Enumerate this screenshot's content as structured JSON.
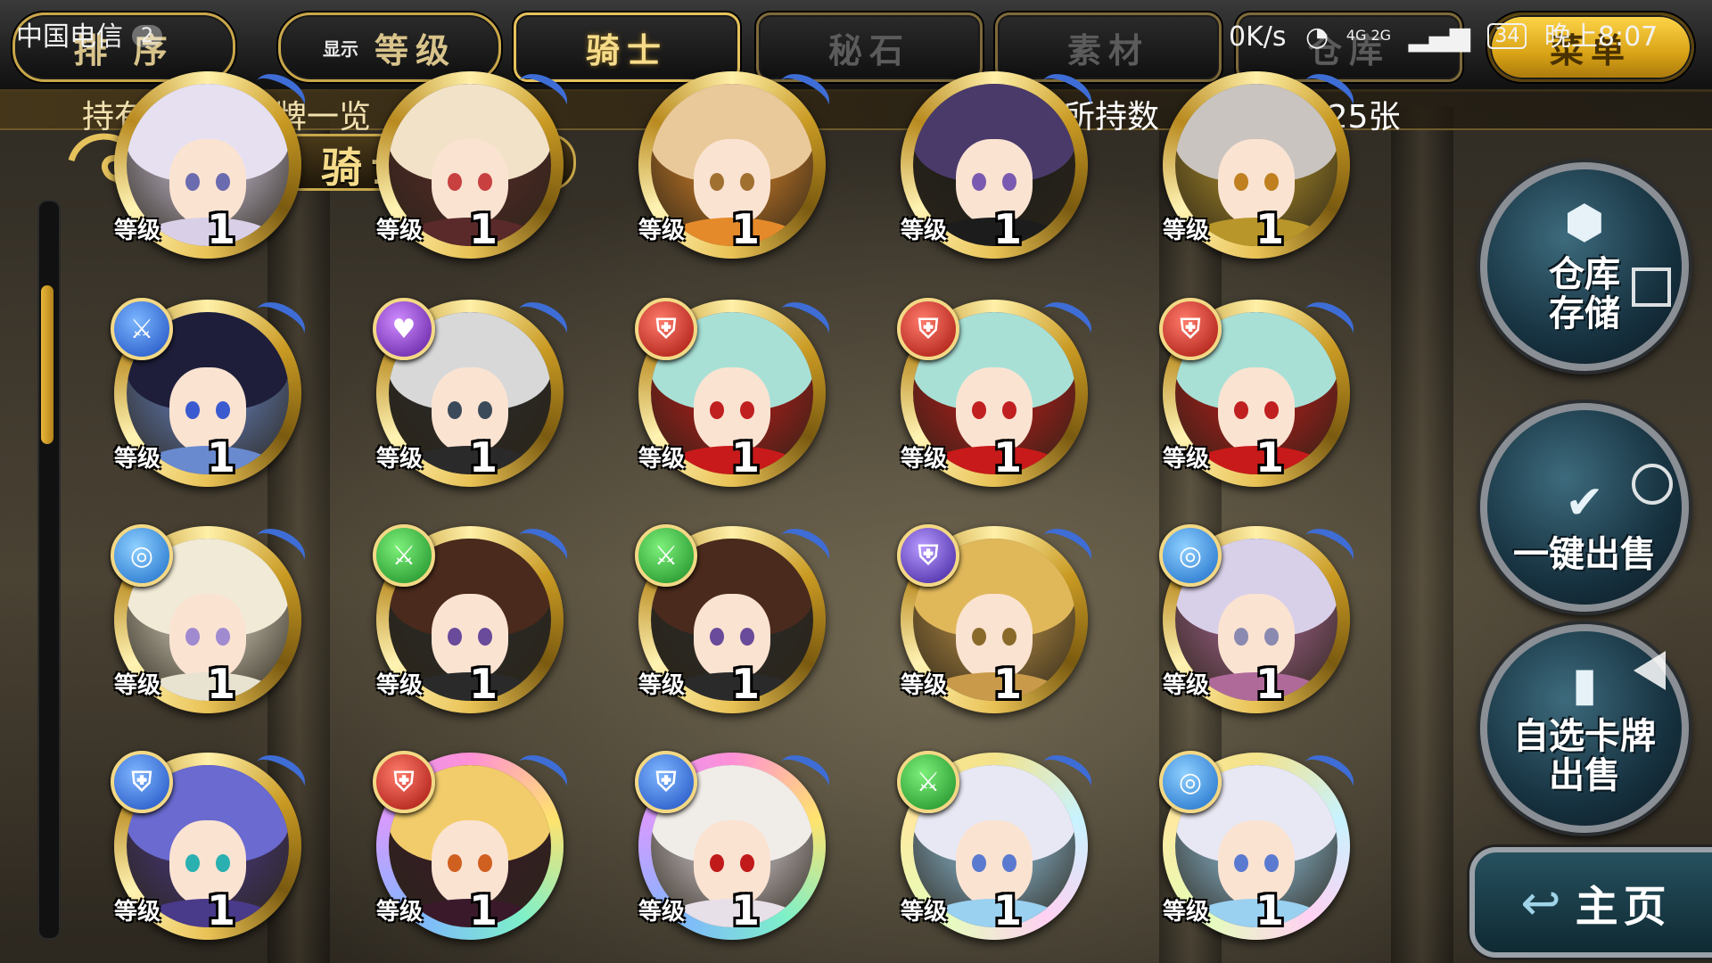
{
  "status_bar": {
    "carrier": "中国电信",
    "notifications": "2",
    "speed": "0K/s",
    "network": "4G 2G",
    "battery": "34",
    "time": "晚上8:07"
  },
  "toolbar": {
    "sort_label": "排 序",
    "display_small": "显示",
    "display_label": "等级",
    "tab_knight": "骑士",
    "tab_secret_stone": "秘石",
    "tab_material": "素材",
    "tab_warehouse": "仓库",
    "menu_label": "菜单"
  },
  "header": {
    "list_title": "持有的骑士卡牌一览",
    "count_label": "所持数",
    "count_value": "102 / 125张"
  },
  "category": {
    "label": "骑士"
  },
  "cards": [
    {
      "attr_icon": "none",
      "lvl_label": "等级",
      "level": "1",
      "hair": "#e6e0f0",
      "eye": "#6b6bb0",
      "cloth": "#d9d0e8"
    },
    {
      "attr_icon": "none",
      "lvl_label": "等级",
      "level": "1",
      "hair": "#f2e2c8",
      "eye": "#c84040",
      "cloth": "#5a2a2a"
    },
    {
      "attr_icon": "none",
      "lvl_label": "等级",
      "level": "1",
      "hair": "#e9c99a",
      "eye": "#a07030",
      "cloth": "#e58a2a"
    },
    {
      "attr_icon": "none",
      "lvl_label": "等级",
      "level": "1",
      "hair": "#4a3a6a",
      "eye": "#7a5ab0",
      "cloth": "#1c1c1c"
    },
    {
      "attr_icon": "none",
      "lvl_label": "等级",
      "level": "1",
      "hair": "#c9c4c0",
      "eye": "#c08020",
      "cloth": "#b8962a"
    },
    {
      "attr_icon": "slash-icon",
      "lvl_label": "等级",
      "level": "1",
      "hair": "#1e1e3a",
      "eye": "#3a5ad0",
      "cloth": "#6a8ad0"
    },
    {
      "attr_icon": "heart-icon",
      "lvl_label": "等级",
      "level": "1",
      "hair": "#d8d8d8",
      "eye": "#3a4a5a",
      "cloth": "#2a2a2a"
    },
    {
      "attr_icon": "shield-icon",
      "lvl_label": "等级",
      "level": "1",
      "hair": "#a8e0d6",
      "eye": "#c02020",
      "cloth": "#c81a1a"
    },
    {
      "attr_icon": "shield-icon",
      "lvl_label": "等级",
      "level": "1",
      "hair": "#a8e0d6",
      "eye": "#c02020",
      "cloth": "#c81a1a"
    },
    {
      "attr_icon": "shield-icon",
      "lvl_label": "等级",
      "level": "1",
      "hair": "#a8e0d6",
      "eye": "#c02020",
      "cloth": "#c81a1a"
    },
    {
      "attr_icon": "spiral-icon",
      "lvl_label": "等级",
      "level": "1",
      "hair": "#f0ead6",
      "eye": "#a08ad0",
      "cloth": "#e8e2d0"
    },
    {
      "attr_icon": "sword-icon",
      "lvl_label": "等级",
      "level": "1",
      "hair": "#4a2a1c",
      "eye": "#6a4a9a",
      "cloth": "#2a2a2a"
    },
    {
      "attr_icon": "sword-icon",
      "lvl_label": "等级",
      "level": "1",
      "hair": "#4a2a1c",
      "eye": "#6a4a9a",
      "cloth": "#2a2a2a"
    },
    {
      "attr_icon": "shield-purple-icon",
      "lvl_label": "等级",
      "level": "1",
      "hair": "#e0b85a",
      "eye": "#8a6a2a",
      "cloth": "#c89a4a"
    },
    {
      "attr_icon": "spiral-icon",
      "lvl_label": "等级",
      "level": "1",
      "hair": "#d8d0e8",
      "eye": "#8a8ab0",
      "cloth": "#b06a9a"
    },
    {
      "attr_icon": "shield-blue-icon",
      "lvl_label": "等级",
      "level": "1",
      "hair": "#6a6ad0",
      "eye": "#2ab0b0",
      "cloth": "#4a3a8a"
    },
    {
      "attr_icon": "shield-icon",
      "lvl_label": "等级",
      "level": "1",
      "hair": "#f2cc6a",
      "eye": "#d06020",
      "cloth": "#3a1a2a"
    },
    {
      "attr_icon": "shield-blue-icon",
      "lvl_label": "等级",
      "level": "1",
      "hair": "#f0ece8",
      "eye": "#c01a1a",
      "cloth": "#e8e0e8"
    },
    {
      "attr_icon": "sword-icon",
      "lvl_label": "等级",
      "level": "1",
      "hair": "#e8e8f4",
      "eye": "#5a7ad0",
      "cloth": "#9ad0f0"
    },
    {
      "attr_icon": "spiral-icon",
      "lvl_label": "等级",
      "level": "1",
      "hair": "#e8e8f4",
      "eye": "#5a7ad0",
      "cloth": "#9ad0f0"
    }
  ],
  "actions": {
    "warehouse_store": "仓库\n存储",
    "one_click_sell": "一键出售",
    "custom_sell": "自选卡牌\n出售",
    "home": "主页"
  },
  "colors": {
    "gold": "#e6c25c",
    "panel_dark": "#1c1c1c",
    "teal_button": "#173240"
  }
}
